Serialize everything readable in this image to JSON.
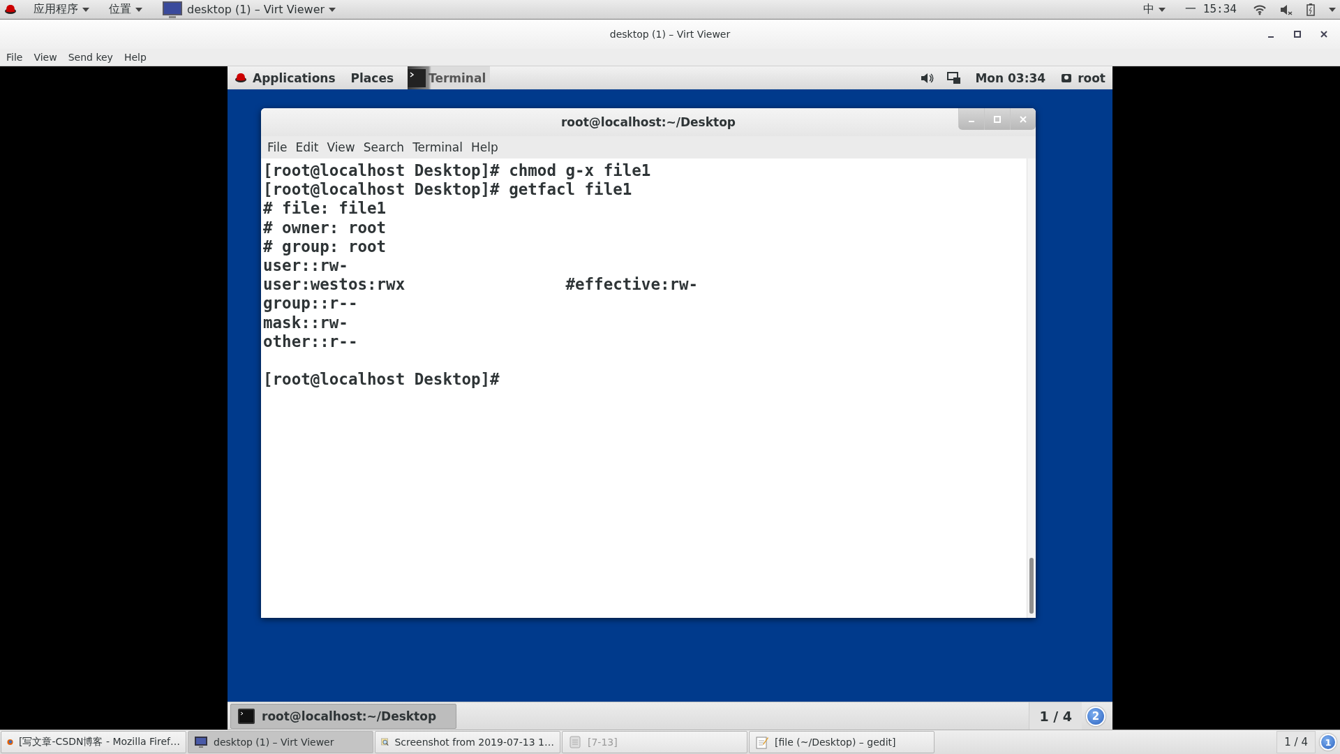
{
  "host_top_bar": {
    "menus": [
      {
        "label": "应用程序"
      },
      {
        "label": "位置"
      }
    ],
    "window_button": "desktop (1) – Virt Viewer",
    "input_method": "中",
    "clock": "一 15:34"
  },
  "window": {
    "title": "desktop (1) – Virt Viewer"
  },
  "menu_bar": [
    "File",
    "View",
    "Send key",
    "Help"
  ],
  "guest": {
    "top_bar": {
      "items": [
        "Applications",
        "Places"
      ],
      "active_app": "Terminal",
      "clock": "Mon 03:34",
      "user": "root"
    },
    "terminal": {
      "title": "root@localhost:~/Desktop",
      "menu": [
        "File",
        "Edit",
        "View",
        "Search",
        "Terminal",
        "Help"
      ],
      "lines": [
        {
          "kind": "text",
          "text": "[root@localhost Desktop]# chmod g-x file1"
        },
        {
          "kind": "text",
          "text": "[root@localhost Desktop]# getfacl file1"
        },
        {
          "kind": "text",
          "text": "# file: file1"
        },
        {
          "kind": "text",
          "text": "# owner: root"
        },
        {
          "kind": "text",
          "text": "# group: root"
        },
        {
          "kind": "text",
          "text": "user::rw-"
        },
        {
          "kind": "text",
          "text": "user:westos:rwx",
          "note": "#effective:rw-"
        },
        {
          "kind": "text",
          "text": "group::r--"
        },
        {
          "kind": "text",
          "text": "mask::rw-"
        },
        {
          "kind": "text",
          "text": "other::r--"
        },
        {
          "kind": "blank"
        },
        {
          "kind": "text",
          "text": "[root@localhost Desktop]#"
        }
      ]
    },
    "bottom_bar": {
      "window": "root@localhost:~/Desktop",
      "workspace": "1 / 4",
      "notifications": "2"
    }
  },
  "taskbar": {
    "items": [
      {
        "label": "[写文章-CSDN博客 - Mozilla Firef…",
        "selected": false,
        "disabled": false
      },
      {
        "label": "desktop (1) – Virt Viewer",
        "selected": true,
        "disabled": false
      },
      {
        "label": "Screenshot from 2019-07-13 1…",
        "selected": false,
        "disabled": false
      },
      {
        "label": "[7-13]",
        "selected": false,
        "disabled": true
      },
      {
        "label": "[file (~/Desktop) – gedit]",
        "selected": false,
        "disabled": false
      }
    ],
    "workspace": "1 / 4",
    "notifications": "1"
  }
}
